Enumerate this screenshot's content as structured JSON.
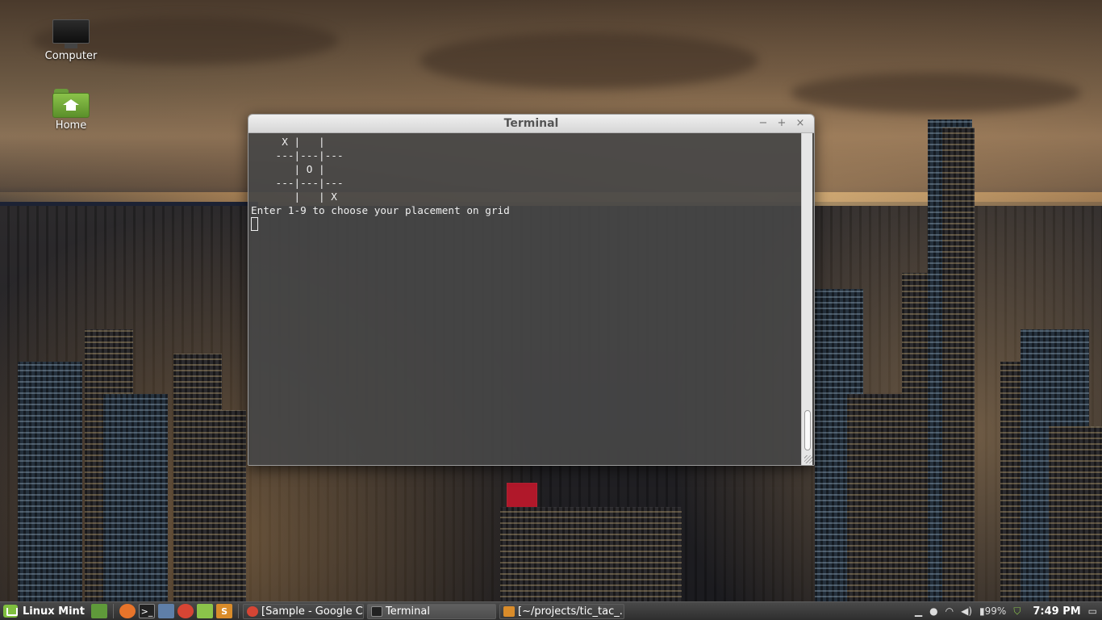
{
  "desktop": {
    "icons": [
      {
        "label": "Computer"
      },
      {
        "label": "Home"
      }
    ]
  },
  "terminal_window": {
    "title": "Terminal",
    "buttons": {
      "minimize": "−",
      "maximize": "+",
      "close": "×"
    },
    "lines": [
      "     X |   |",
      "    ---|---|---",
      "       | O |",
      "    ---|---|---",
      "       |   | X",
      "Enter 1-9 to choose your placement on grid"
    ]
  },
  "panel": {
    "menu_label": "Linux Mint",
    "launchers": [
      {
        "icon": "show-desktop-icon",
        "color": "#5f9a3a"
      },
      {
        "icon": "firefox-icon",
        "color": "#e8742a"
      },
      {
        "icon": "terminal-icon",
        "color": "#222222"
      },
      {
        "icon": "screenshot-icon",
        "color": "#5f7fa8"
      },
      {
        "icon": "chrome-icon",
        "color": "#d64534"
      },
      {
        "icon": "files-icon",
        "color": "#8bc34a"
      },
      {
        "icon": "sublime-text-icon",
        "color": "#d98c2a"
      }
    ],
    "tasks": [
      {
        "label": "[Sample - Google C...",
        "icon": "chrome-icon",
        "color": "#d64534",
        "active": false
      },
      {
        "label": "Terminal",
        "icon": "terminal-icon",
        "color": "#222222",
        "active": true
      },
      {
        "label": "[~/projects/tic_tac_...",
        "icon": "sublime-text-icon",
        "color": "#d98c2a",
        "active": false
      }
    ],
    "tray": {
      "battery": "99%",
      "clock": "7:49 PM"
    }
  }
}
